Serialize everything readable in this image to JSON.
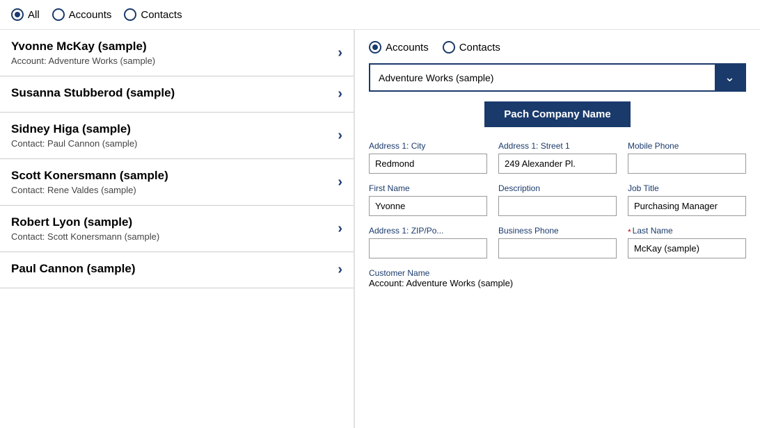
{
  "top_filter": {
    "options": [
      {
        "label": "All",
        "checked": true
      },
      {
        "label": "Accounts",
        "checked": false
      },
      {
        "label": "Contacts",
        "checked": false
      }
    ]
  },
  "list": {
    "items": [
      {
        "name": "Yvonne McKay (sample)",
        "sub": "Account: Adventure Works (sample)"
      },
      {
        "name": "Susanna Stubberod (sample)",
        "sub": ""
      },
      {
        "name": "Sidney Higa (sample)",
        "sub": "Contact: Paul Cannon (sample)"
      },
      {
        "name": "Scott Konersmann (sample)",
        "sub": "Contact: Rene Valdes (sample)"
      },
      {
        "name": "Robert Lyon (sample)",
        "sub": "Contact: Scott Konersmann (sample)"
      },
      {
        "name": "Paul Cannon (sample)",
        "sub": ""
      }
    ]
  },
  "right_panel": {
    "filter": {
      "options": [
        {
          "label": "Accounts",
          "checked": true
        },
        {
          "label": "Contacts",
          "checked": false
        }
      ]
    },
    "dropdown": {
      "value": "Adventure Works (sample)",
      "chevron": "⌄"
    },
    "patch_button_label": "Pach Company Name",
    "fields": {
      "address1_city_label": "Address 1: City",
      "address1_city_value": "Redmond",
      "address1_street1_label": "Address 1: Street 1",
      "address1_street1_value": "249 Alexander Pl.",
      "mobile_phone_label": "Mobile Phone",
      "mobile_phone_value": "",
      "first_name_label": "First Name",
      "first_name_value": "Yvonne",
      "description_label": "Description",
      "description_value": "",
      "job_title_label": "Job Title",
      "job_title_value": "Purchasing Manager",
      "address1_zip_label": "Address 1: ZIP/Po...",
      "address1_zip_value": "",
      "business_phone_label": "Business Phone",
      "business_phone_value": "",
      "last_name_label": "Last Name",
      "last_name_value": "McKay (sample)"
    },
    "customer_name_label": "Customer Name",
    "customer_name_value": "Account: Adventure Works (sample)"
  },
  "colors": {
    "accent": "#1a3a6b"
  }
}
